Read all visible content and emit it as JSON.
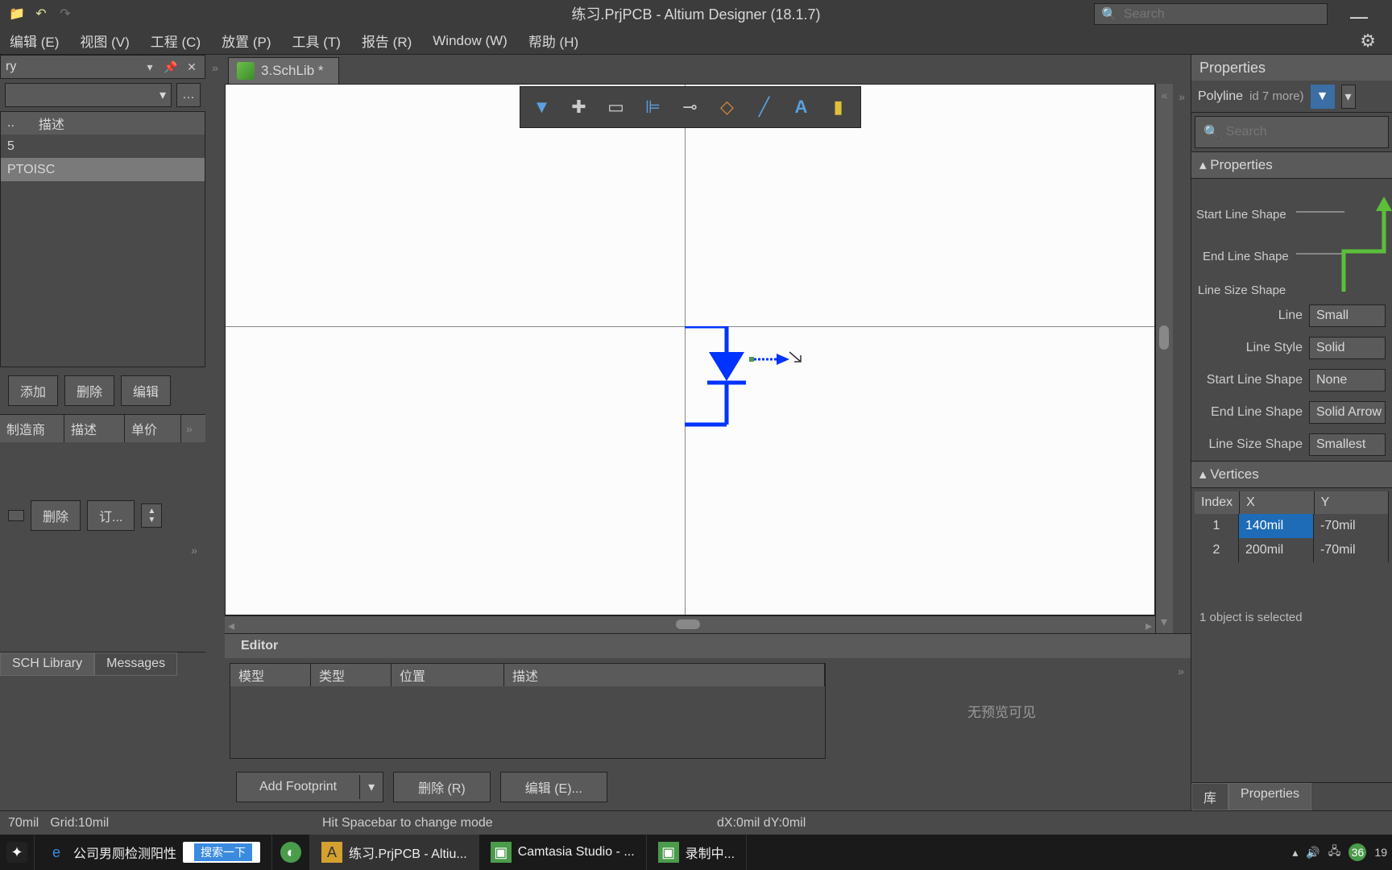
{
  "title": "练习.PrjPCB - Altium Designer (18.1.7)",
  "search_placeholder": "Search",
  "menu": [
    "编辑 (E)",
    "视图 (V)",
    "工程 (C)",
    "放置 (P)",
    "工具 (T)",
    "报告 (R)",
    "Window (W)",
    "帮助 (H)"
  ],
  "left": {
    "header": "ry",
    "columns": [
      "..",
      "描述"
    ],
    "rows": [
      "5",
      "PTOISC"
    ],
    "btns": [
      "添加",
      "删除",
      "编辑"
    ],
    "mfg_cols": [
      "制造商",
      "描述",
      "单价"
    ],
    "btns2": [
      "删除",
      "订..."
    ],
    "bottom_tabs": [
      "SCH Library",
      "Messages"
    ]
  },
  "tab_name": "3.SchLib *",
  "editor": {
    "title": "Editor",
    "cols": [
      "模型",
      "类型",
      "位置",
      "描述"
    ],
    "preview": "无预览可见",
    "add_fp": "Add Footprint",
    "del": "删除 (R)",
    "edit": "编辑 (E)..."
  },
  "props": {
    "title": "Properties",
    "sel_object": "Polyline",
    "sel_more": "id 7 more)",
    "search_placeholder": "Search",
    "section1": "Properties",
    "shape_labels": [
      "Start Line Shape",
      "End Line Shape",
      "Line Size Shape"
    ],
    "rows": [
      {
        "label": "Line",
        "value": "Small"
      },
      {
        "label": "Line Style",
        "value": "Solid"
      },
      {
        "label": "Start Line Shape",
        "value": "None"
      },
      {
        "label": "End Line Shape",
        "value": "Solid Arrow"
      },
      {
        "label": "Line Size Shape",
        "value": "Smallest"
      }
    ],
    "section2": "Vertices",
    "vert_cols": [
      "Index",
      "X",
      "Y"
    ],
    "verts": [
      {
        "i": "1",
        "x": "140mil",
        "y": "-70mil"
      },
      {
        "i": "2",
        "x": "200mil",
        "y": "-70mil"
      }
    ],
    "sel_status": "1 object is selected",
    "bottom_tabs": [
      "库",
      "Properties"
    ]
  },
  "status": {
    "left1": "70mil",
    "left2": "Grid:10mil",
    "mid": "Hit Spacebar to change mode",
    "right": "dX:0mil dY:0mil"
  },
  "taskbar": {
    "items": [
      "公司男厕检测阳性",
      "练习.PrjPCB - Altiu...",
      "Camtasia Studio - ...",
      "录制中..."
    ],
    "search_btn": "搜索一下",
    "tray_num": "36",
    "clock": "19"
  }
}
